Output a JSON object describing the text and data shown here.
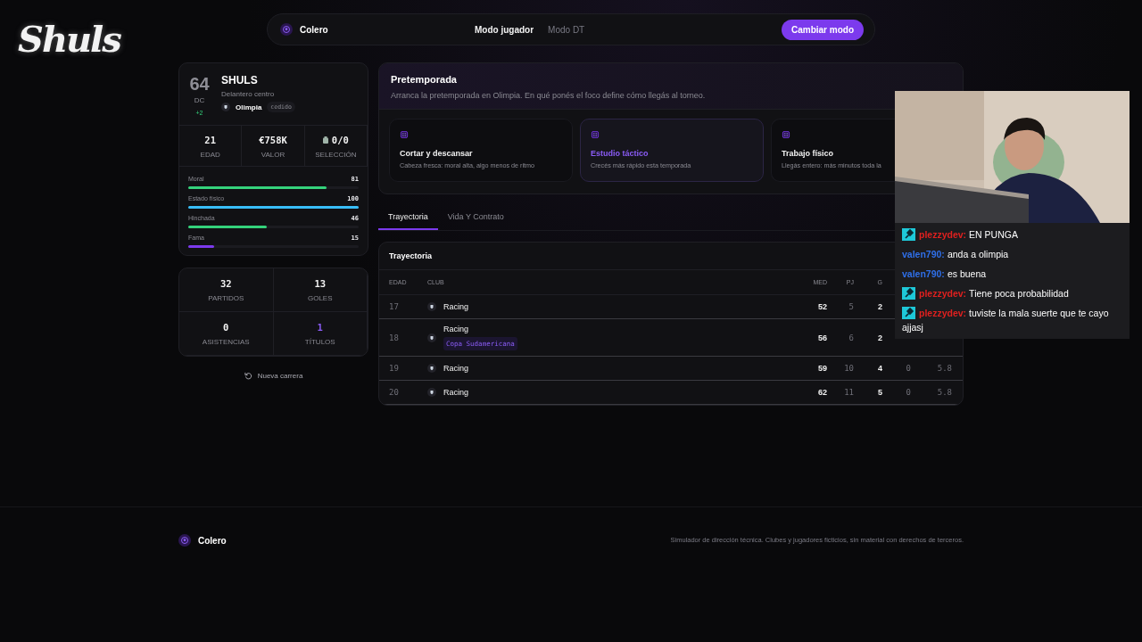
{
  "logo": "Shuls",
  "topbar": {
    "brand": "Colero",
    "modes": [
      {
        "label": "Modo jugador",
        "selected": true
      },
      {
        "label": "Modo DT",
        "selected": false
      }
    ],
    "button": "Cambiar modo"
  },
  "player": {
    "rating": "64",
    "position": "DC",
    "delta": "+2",
    "name": "SHULS",
    "role": "Delantero centro",
    "club": "Olimpia",
    "tag": "cedido",
    "stats": [
      {
        "value": "21",
        "label": "EDAD",
        "kind": "plain"
      },
      {
        "value": "€758K",
        "label": "VALOR",
        "kind": "plain"
      },
      {
        "value": "0/0",
        "label": "SELECCIÓN",
        "kind": "shirt"
      }
    ],
    "bars": [
      {
        "label": "Moral",
        "reading": "81",
        "level": 0.81,
        "color": "#34d27b"
      },
      {
        "label": "Estado físico",
        "reading": "100",
        "level": 1,
        "color": "#38bdf8"
      },
      {
        "label": "Hinchada",
        "reading": "46",
        "level": 0.46,
        "color": "#34d27b"
      },
      {
        "label": "Fama",
        "reading": "15",
        "level": 0.15,
        "color": "#7c3aed"
      }
    ]
  },
  "career": [
    {
      "value": "32",
      "label": "PARTIDOS",
      "highlight": false
    },
    {
      "value": "13",
      "label": "GOLES",
      "highlight": false
    },
    {
      "value": "0",
      "label": "ASISTENCIAS",
      "highlight": false
    },
    {
      "value": "1",
      "label": "TÍTULOS",
      "highlight": true
    }
  ],
  "new_career": "Nueva carrera",
  "preseason": {
    "title": "Pretemporada",
    "description": "Arranca la pretemporada en Olimpia. En qué ponés el foco define cómo llegás al torneo.",
    "options": [
      {
        "title": "Cortar y descansar",
        "subtitle": "Cabeza fresca: moral alta, algo menos de ritmo",
        "selected": false
      },
      {
        "title": "Estudio táctico",
        "subtitle": "Crecés más rápido esta temporada",
        "selected": true
      },
      {
        "title": "Trabajo físico",
        "subtitle": "Llegás entero: más minutos toda la",
        "selected": false
      }
    ]
  },
  "tabs": [
    {
      "label": "Trayectoria",
      "selected": true
    },
    {
      "label": "Vida Y Contrato",
      "selected": false
    }
  ],
  "table": {
    "title": "Trayectoria",
    "columns": [
      "EDAD",
      "CLUB",
      "MED",
      "PJ",
      "G",
      null,
      null
    ],
    "rows": [
      {
        "cells": [
          "17",
          "Racing",
          "52",
          "5",
          "2",
          null,
          null
        ]
      },
      {
        "cells": [
          "18",
          "Racing",
          "56",
          "6",
          "2",
          null,
          null
        ],
        "competition": "Copa Sudamericana"
      },
      {
        "cells": [
          "19",
          "Racing",
          "59",
          "10",
          "4",
          "0",
          "5.8"
        ]
      },
      {
        "cells": [
          "20",
          "Racing",
          "62",
          "11",
          "5",
          "0",
          "5.8"
        ]
      }
    ]
  },
  "footer": {
    "brand": "Colero",
    "note": "Simulador de dirección técnica. Clubes y jugadores ficticios, sin material con derechos de terceros."
  },
  "stream": {
    "chat": [
      {
        "user": "plezzydev:",
        "color": "#e0201f",
        "badge": true,
        "text": "EN PUNGA"
      },
      {
        "user": "valen790:",
        "color": "#2f6fe8",
        "badge": false,
        "text": "anda a olimpia"
      },
      {
        "user": "valen790:",
        "color": "#2f6fe8",
        "badge": false,
        "text": "es buena"
      },
      {
        "user": "plezzydev:",
        "color": "#e0201f",
        "badge": true,
        "text": "Tiene poca probabilidad"
      },
      {
        "user": "plezzydev:",
        "color": "#e0201f",
        "badge": true,
        "text": "tuviste la mala suerte que te cayo ajjasj"
      }
    ]
  }
}
